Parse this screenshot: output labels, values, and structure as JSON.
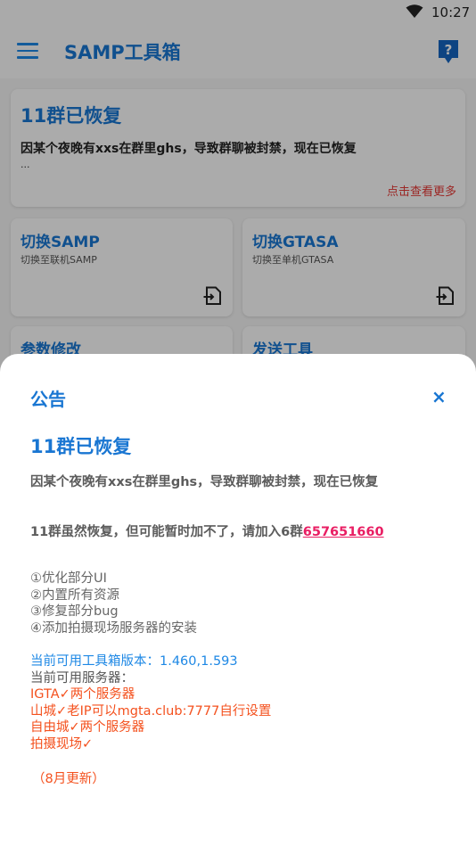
{
  "status_bar": {
    "time": "10:27"
  },
  "app_bar": {
    "title": "SAMP工具箱"
  },
  "notice_card": {
    "title": "11群已恢复",
    "body": "因某个夜晚有xxs在群里ghs，导致群聊被封禁，现在已恢复",
    "ellipsis": "...",
    "more_label": "点击查看更多"
  },
  "tools": [
    {
      "title": "切换SAMP",
      "subtitle": "切换至联机SAMP"
    },
    {
      "title": "切换GTASA",
      "subtitle": "切换至单机GTASA"
    },
    {
      "title": "参数修改",
      "subtitle": ""
    },
    {
      "title": "发送工具",
      "subtitle": ""
    }
  ],
  "dialog": {
    "title": "公告",
    "close_label": "×",
    "heading": "11群已恢复",
    "para1": "因某个夜晚有xxs在群里ghs，导致群聊被封禁，现在已恢复",
    "para2_prefix": "11群虽然恢复，但可能暂时加不了，请加入6群",
    "para2_link": "657651660",
    "changelog": [
      "①优化部分UI",
      "②内置所有资源",
      "③修复部分bug",
      "④添加拍摄现场服务器的安装"
    ],
    "version_line": "当前可用工具箱版本：1.460,1.593",
    "servers_label": "当前可用服务器：",
    "servers": [
      "IGTA✓两个服务器",
      "山城✓老IP可以mgta.club:7777自行设置",
      "自由城✓两个服务器",
      "拍摄现场✓"
    ],
    "footer": "（8月更新）"
  },
  "colors": {
    "accent": "#1976d2",
    "link": "#e91e63",
    "warning": "#f4511e",
    "more": "#e53935"
  },
  "icons": [
    "wifi-icon",
    "menu-icon",
    "help-icon",
    "switch-icon",
    "close-icon"
  ]
}
